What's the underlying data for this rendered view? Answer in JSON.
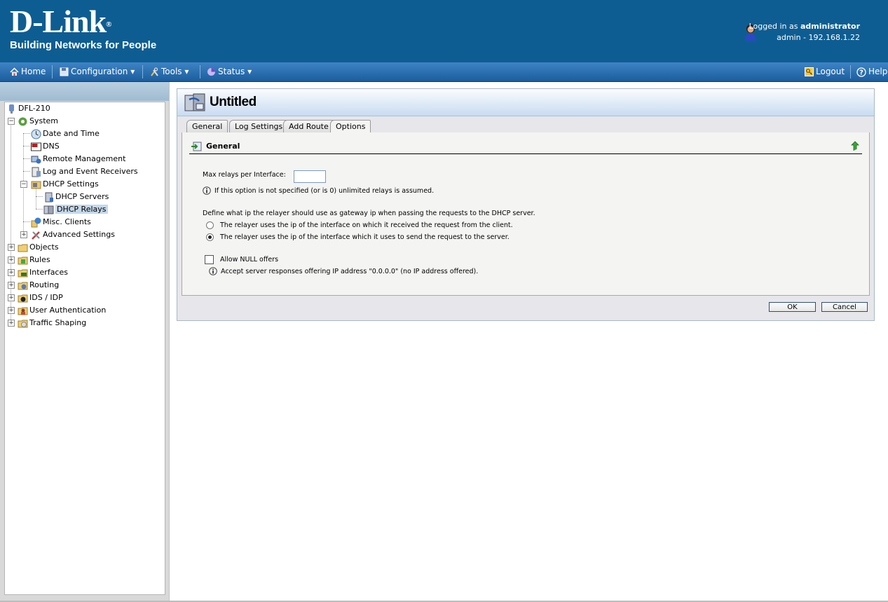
{
  "header": {
    "brand": "D-Link",
    "tagline": "Building Networks for People",
    "logged_in_prefix": "Logged in as ",
    "user": "administrator",
    "session": "admin - 192.168.1.22"
  },
  "nav": {
    "home": "Home",
    "configuration": "Configuration",
    "tools": "Tools",
    "status": "Status",
    "logout": "Logout",
    "help": "Help"
  },
  "tree": {
    "root": "DFL-210",
    "system": "System",
    "date_time": "Date and Time",
    "dns": "DNS",
    "remote_mgmt": "Remote Management",
    "log_receivers": "Log and Event Receivers",
    "dhcp_settings": "DHCP Settings",
    "dhcp_servers": "DHCP Servers",
    "dhcp_relays": "DHCP Relays",
    "misc_clients": "Misc. Clients",
    "advanced_settings": "Advanced Settings",
    "objects": "Objects",
    "rules": "Rules",
    "interfaces": "Interfaces",
    "routing": "Routing",
    "ids_idp": "IDS / IDP",
    "user_auth": "User Authentication",
    "traffic_shaping": "Traffic Shaping"
  },
  "page": {
    "title": "Untitled",
    "tabs": [
      "General",
      "Log Settings",
      "Add Route",
      "Options"
    ],
    "active_tab": "Options",
    "section_title": "General",
    "max_relays_label": "Max relays per Interface:",
    "max_relays_value": "",
    "max_relays_hint": "If this option is not specified (or is 0) unlimited relays is assumed.",
    "gateway_question": "Define what ip the relayer should use as gateway ip when passing the requests to the DHCP server.",
    "radio_option_1": "The relayer uses the ip of the interface on which it received the request from the client.",
    "radio_option_2": "The relayer uses the ip of the interface which it uses to send the request to the server.",
    "selected_option": 2,
    "allow_null_label": "Allow NULL offers",
    "allow_null_checked": false,
    "allow_null_hint": "Accept server responses offering IP address \"0.0.0.0\" (no IP address offered).",
    "ok_label": "OK",
    "cancel_label": "Cancel"
  },
  "colors": {
    "header_bg": "#0e5d92",
    "nav_bg": "#1b5d9e",
    "tree_selected": "#c5d8ea"
  }
}
